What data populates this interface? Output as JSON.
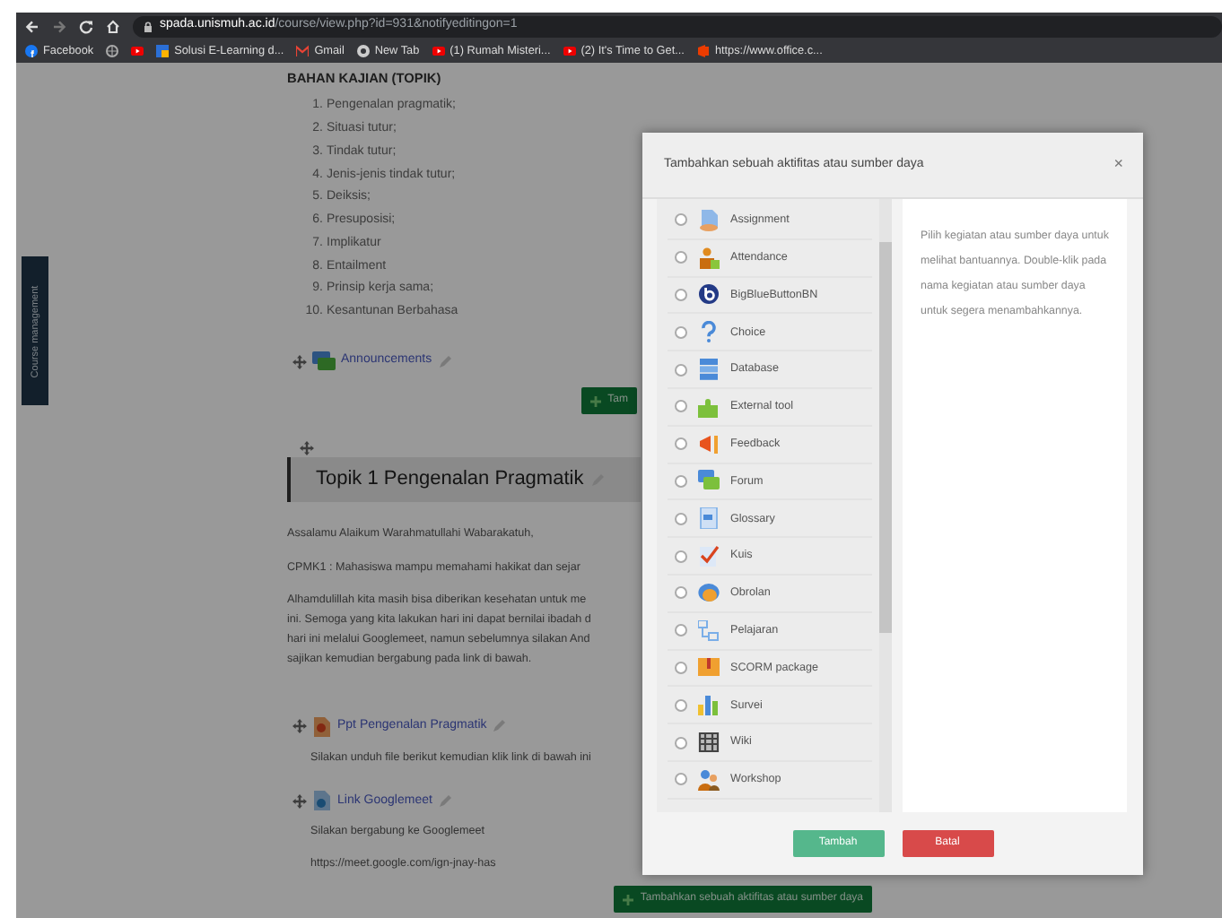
{
  "browser": {
    "url_host": "spada.unismuh.ac.id",
    "url_path": "/course/view.php?id=931&notifyeditingon=1",
    "bookmarks": [
      {
        "kind": "labeled",
        "label": "Facebook"
      },
      {
        "kind": "icon"
      },
      {
        "kind": "icon"
      },
      {
        "kind": "labeled",
        "label": "Solusi E-Learning d..."
      },
      {
        "kind": "labeled",
        "label": "Gmail"
      },
      {
        "kind": "labeled",
        "label": "New Tab"
      },
      {
        "kind": "labeled",
        "label": "(1) Rumah Misteri..."
      },
      {
        "kind": "labeled",
        "label": "(2) It's Time to Get..."
      },
      {
        "kind": "labeled",
        "label": "https://www.office.c..."
      }
    ]
  },
  "side_tab": "Course management",
  "course": {
    "section_heading": "BAHAN KAJIAN (TOPIK)",
    "topics": [
      {
        "number": "1.",
        "text": "Pengenalan pragmatik;"
      },
      {
        "number": "2.",
        "text": "Situasi tutur;"
      },
      {
        "number": "3.",
        "text": "Tindak tutur;"
      },
      {
        "number": "4.",
        "text": "Jenis-jenis tindak tutur;"
      },
      {
        "number": "5.",
        "text": "Deiksis;"
      },
      {
        "number": "6.",
        "text": "Presuposisi;"
      },
      {
        "number": "7.",
        "text": "Implikatur"
      },
      {
        "number": "8.",
        "text": "Entailment"
      },
      {
        "number": "9.",
        "text": "Prinsip kerja sama;"
      },
      {
        "number": "10.",
        "text": "Kesantunan Berbahasa"
      }
    ],
    "announcements_link": "Announcements",
    "add_button_cut": "Tam",
    "topic_title": "Topik 1 Pengenalan Pragmatik",
    "greeting": "Assalamu Alaikum Warahmatullahi Wabarakatuh,",
    "cpmk": "CPMK1 :  Mahasiswa mampu memahami hakikat dan sejar",
    "paragraph_lines": [
      "Alhamdulillah kita masih bisa diberikan kesehatan untuk me",
      "ini. Semoga yang kita lakukan hari ini dapat bernilai ibadah d",
      "hari ini melalui Googlemeet, namun sebelumnya silakan And",
      "sajikan kemudian bergabung pada link di bawah."
    ],
    "resources": [
      {
        "kind": "ppt",
        "title": "Ppt Pengenalan Pragmatik",
        "lines": [
          "Silakan unduh file berikut kemudian klik link di bawah ini"
        ]
      },
      {
        "kind": "url",
        "title": "Link Googlemeet",
        "lines": [
          "Silakan bergabung ke Googlemeet",
          "https://meet.google.com/ign-jnay-has"
        ]
      }
    ],
    "add_button": "Tambahkan sebuah aktifitas atau sumber daya"
  },
  "modal": {
    "title": "Tambahkan sebuah aktifitas atau sumber daya",
    "close": "×",
    "activities": [
      {
        "label": "Assignment",
        "selected": false
      },
      {
        "label": "Attendance",
        "selected": false
      },
      {
        "label": "BigBlueButtonBN",
        "selected": false
      },
      {
        "label": "Choice",
        "selected": false
      },
      {
        "label": "Database",
        "selected": false
      },
      {
        "label": "External tool",
        "selected": false
      },
      {
        "label": "Feedback",
        "selected": false
      },
      {
        "label": "Forum",
        "selected": false
      },
      {
        "label": "Glossary",
        "selected": false
      },
      {
        "label": "Kuis",
        "selected": false
      },
      {
        "label": "Obrolan",
        "selected": false
      },
      {
        "label": "Pelajaran",
        "selected": false
      },
      {
        "label": "SCORM package",
        "selected": false
      },
      {
        "label": "Survei",
        "selected": false
      },
      {
        "label": "Wiki",
        "selected": false
      },
      {
        "label": "Workshop",
        "selected": false
      }
    ],
    "help": "Pilih kegiatan atau sumber daya untuk melihat bantuannya. Double-klik pada nama kegiatan atau sumber daya untuk segera menambahkannya.",
    "buttons": [
      {
        "kind": "primary",
        "label": "Tambah"
      },
      {
        "kind": "cancel",
        "label": "Batal"
      }
    ]
  }
}
